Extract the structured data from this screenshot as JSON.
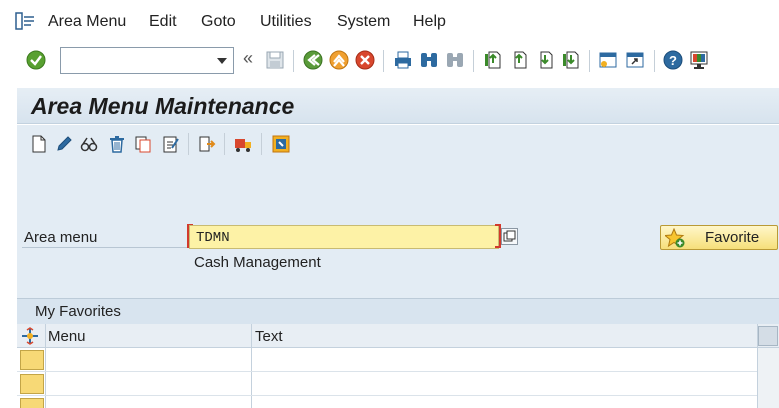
{
  "menubar": {
    "items": [
      {
        "label": "Area Menu"
      },
      {
        "label": "Edit"
      },
      {
        "label": "Goto"
      },
      {
        "label": "Utilities"
      },
      {
        "label": "System"
      },
      {
        "label": "Help"
      }
    ]
  },
  "toolbar": {
    "command_field_value": "",
    "icons": [
      "enter-check-icon",
      "save-icon",
      "back-icon",
      "exit-icon",
      "cancel-icon",
      "print-icon",
      "find-icon",
      "find-next-icon",
      "first-page-icon",
      "previous-page-icon",
      "next-page-icon",
      "last-page-icon",
      "create-session-icon",
      "shortcut-icon",
      "help-icon",
      "customize-layout-icon"
    ]
  },
  "title": "Area Menu Maintenance",
  "app_toolbar": {
    "icons": [
      "create-icon",
      "change-icon",
      "display-icon",
      "delete-icon",
      "copy-icon",
      "check-icon",
      "translate-icon",
      "transport-icon",
      "where-used-icon"
    ]
  },
  "form": {
    "area_menu_label": "Area menu",
    "area_menu_value": "TDMN",
    "area_menu_description": "Cash Management",
    "favorite_button_label": "Favorite"
  },
  "favorites": {
    "title": "My Favorites",
    "columns": [
      "Menu",
      "Text"
    ],
    "rows": [
      {
        "menu": "",
        "text": ""
      },
      {
        "menu": "",
        "text": ""
      },
      {
        "menu": "",
        "text": ""
      }
    ]
  },
  "colors": {
    "content_bg": "#e3ecf4",
    "required_field_bg": "#fdf2a6",
    "favorite_button": "#f6df7a"
  }
}
